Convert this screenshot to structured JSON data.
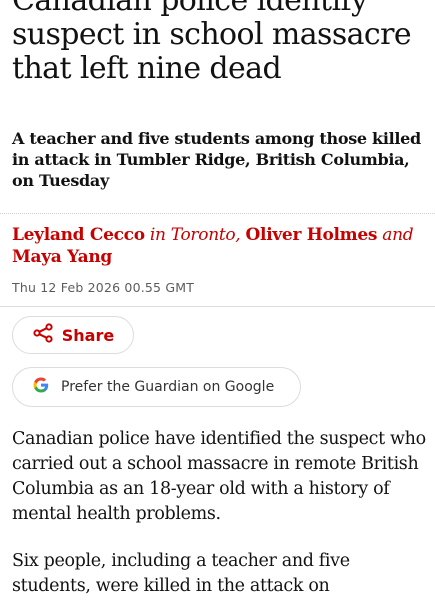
{
  "article": {
    "headline": "Canadian police identify suspect in school massacre that left nine dead",
    "standfirst": "A teacher and five students among those killed in attack in Tumbler Ridge, British Columbia, on Tuesday",
    "byline": {
      "author1": "Leyland Cecco",
      "location_text": "in Toronto,",
      "author2": "Oliver Holmes",
      "conjunction": "and",
      "author3": "Maya Yang"
    },
    "dateline": "Thu 12 Feb 2026 00.55 GMT",
    "paragraphs": [
      "Canadian police have identified the suspect who carried out a school massacre in remote British Columbia as an 18-year old with a history of mental health problems.",
      "Six people, including a teacher and five students, were killed in the attack on"
    ]
  },
  "actions": {
    "share_label": "Share",
    "google_label": "Prefer the Guardian on Google"
  },
  "colors": {
    "accent": "#c70000",
    "text": "#121212",
    "meta": "#5c5c5c",
    "border": "#dcdcdc"
  },
  "icons": {
    "share": "share-icon",
    "google": "google-g-icon"
  }
}
